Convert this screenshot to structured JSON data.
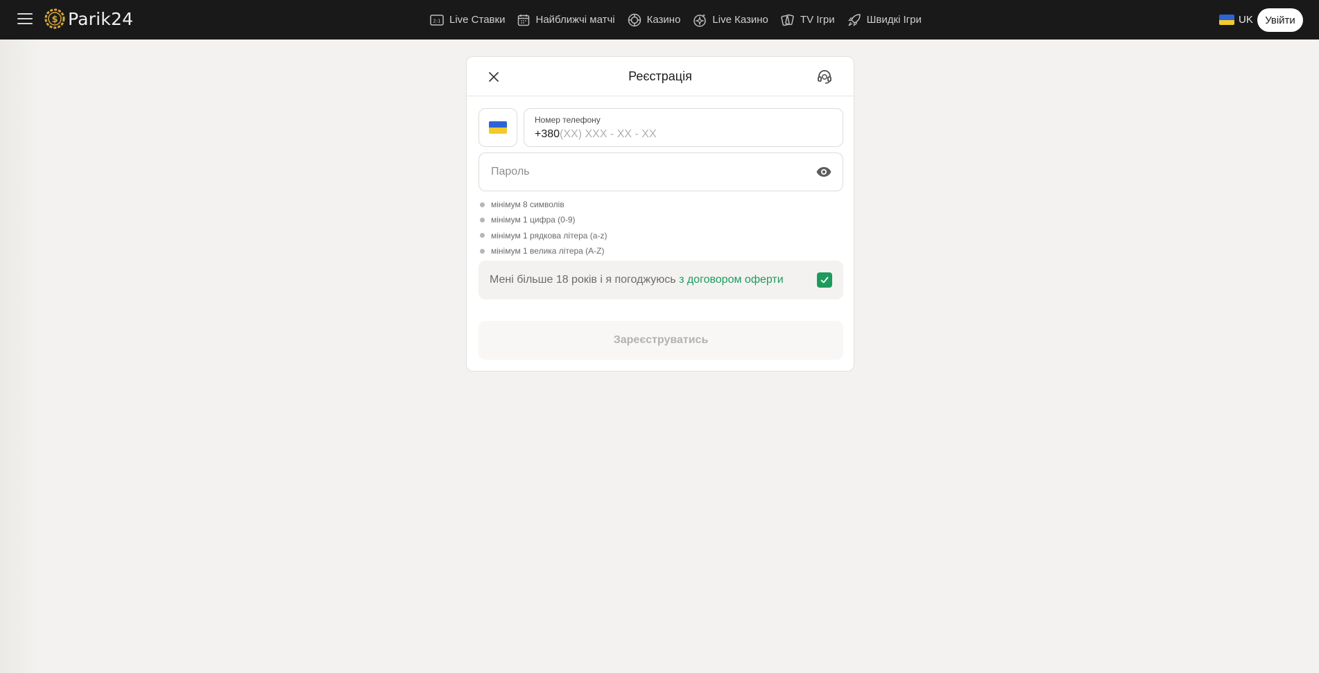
{
  "header": {
    "logo_text": "Parik24",
    "nav": [
      {
        "label": "Live Ставки",
        "icon": "live-bets-icon"
      },
      {
        "label": "Найближчі матчі",
        "icon": "calendar-icon"
      },
      {
        "label": "Казино",
        "icon": "casino-chip-icon"
      },
      {
        "label": "Live Казино",
        "icon": "live-casino-icon"
      },
      {
        "label": "TV Ігри",
        "icon": "tv-games-cards-icon"
      },
      {
        "label": "Швидкі Ігри",
        "icon": "rocket-icon"
      }
    ],
    "language": "UK",
    "login_label": "Увійти"
  },
  "modal": {
    "title": "Реєстрація",
    "phone": {
      "label": "Номер телефону",
      "prefix": "+380",
      "mask": "(XX) XXX - XX - XX"
    },
    "password": {
      "placeholder": "Пароль"
    },
    "rules": [
      "мінімум 8 символів",
      "мінімум 1 цифра (0-9)",
      "мінімум 1 рядкова літера (a-z)",
      "мінімум 1 велика літера (A-Z)"
    ],
    "consent": {
      "text": "Мені більше 18 років і я погоджуюсь ",
      "link": "з договором оферти",
      "checked": true
    },
    "submit_label": "Зареєструватись"
  },
  "colors": {
    "header_bg": "#191919",
    "page_bg": "#f3f2f0",
    "accent_green": "#1d9a5c",
    "flag_blue": "#2d63d6",
    "flag_yellow": "#f2cb2b"
  }
}
